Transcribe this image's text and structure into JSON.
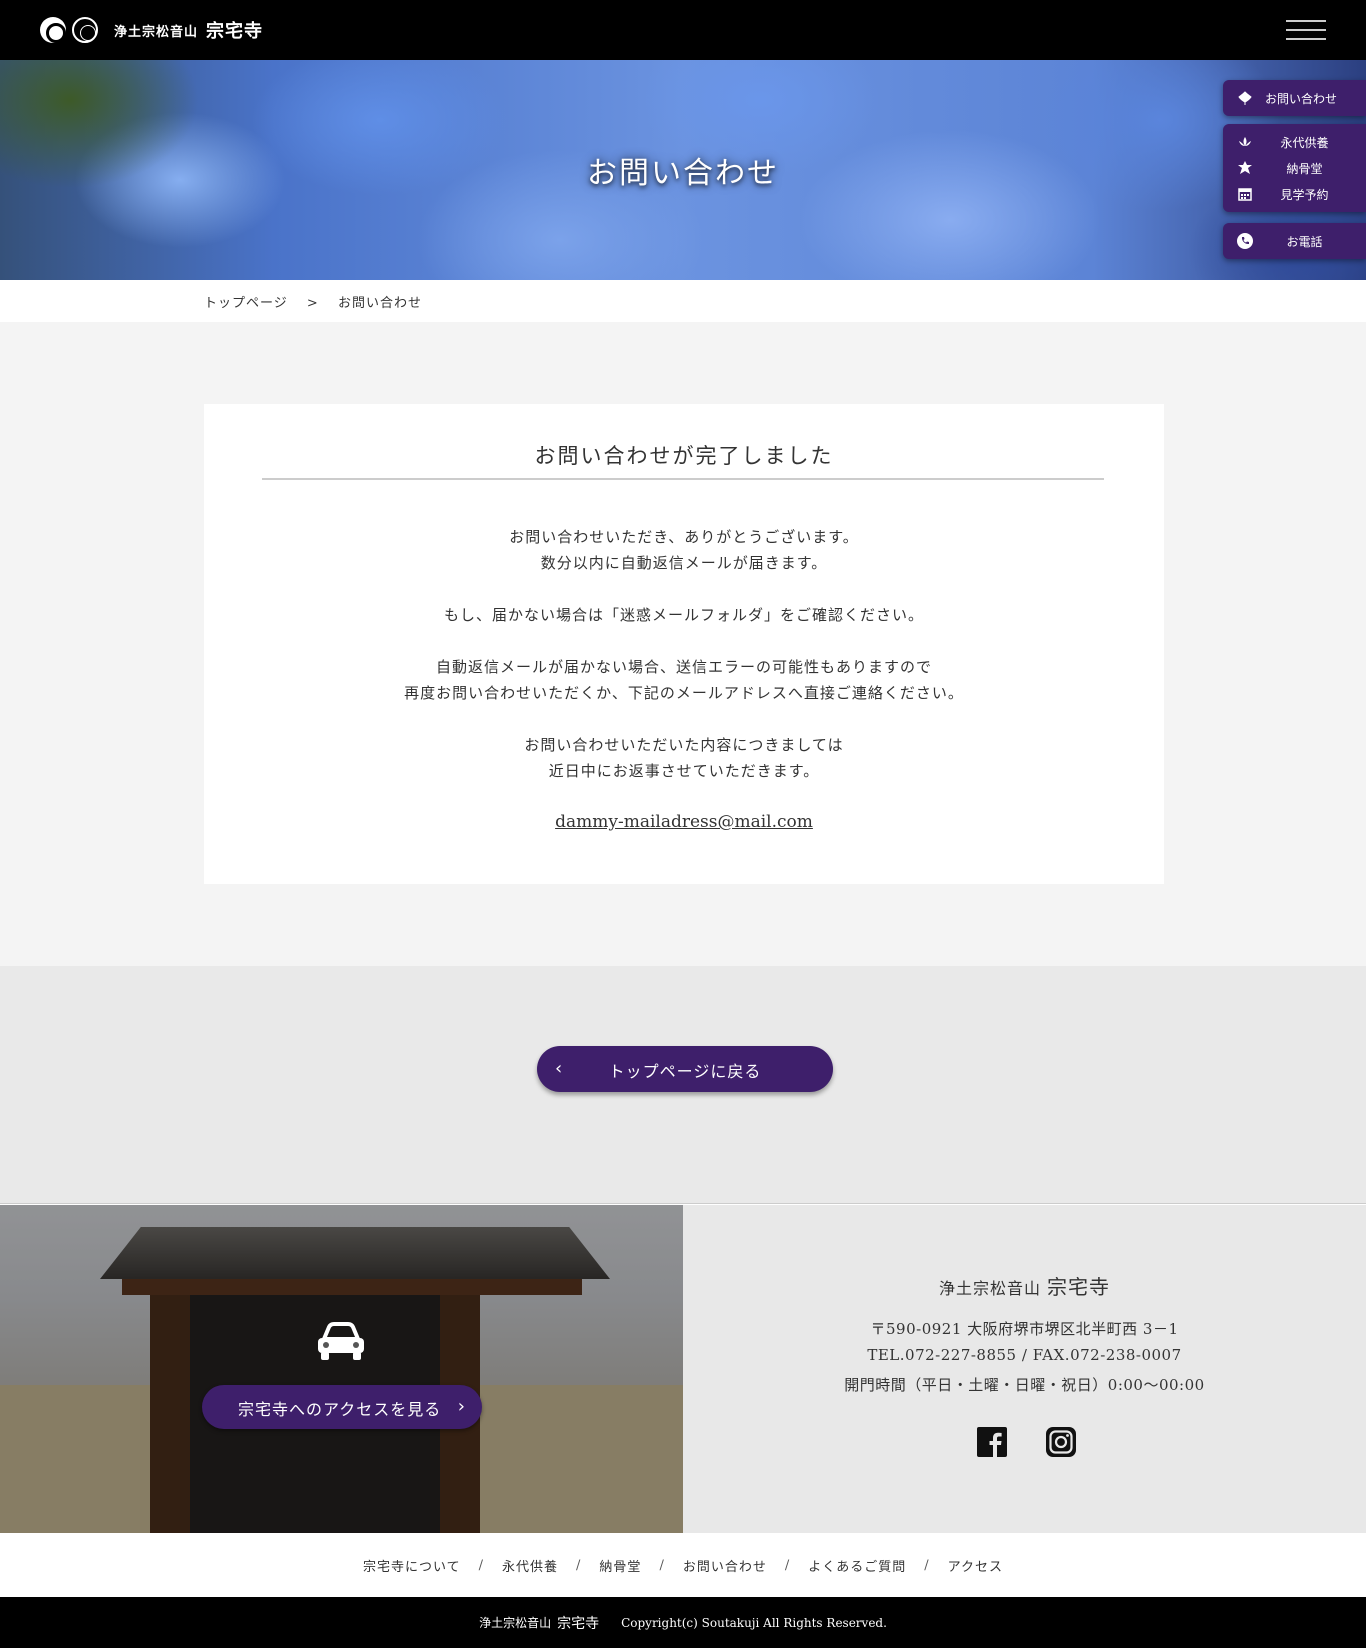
{
  "header": {
    "logo_small": "浄土宗松音山",
    "logo_big": "宗宅寺",
    "menu_icon": "hamburger-menu-icon"
  },
  "hero": {
    "title": "お問い合わせ"
  },
  "side_nav": {
    "contact": {
      "label": "お問い合わせ",
      "icon": "lotus-icon"
    },
    "links": [
      {
        "label": "永代供養",
        "icon": "lotus-flower-icon"
      },
      {
        "label": "納骨堂",
        "icon": "leaf-icon"
      },
      {
        "label": "見学予約",
        "icon": "calendar-icon"
      }
    ],
    "phone": {
      "label": "お電話",
      "icon": "phone-icon"
    }
  },
  "breadcrumb": {
    "home": "トップページ",
    "separator": ">",
    "current": "お問い合わせ"
  },
  "card": {
    "title": "お問い合わせが完了しました",
    "lines": [
      "お問い合わせいただき、ありがとうございます。",
      "数分以内に自動返信メールが届きます。",
      "もし、届かない場合は「迷惑メールフォルダ」をご確認ください。",
      "自動返信メールが届かない場合、送信エラーの可能性もありますので",
      "再度お問い合わせいただくか、下記のメールアドレスへ直接ご連絡ください。",
      "お問い合わせいただいた内容につきましては",
      "近日中にお返事させていただきます。"
    ],
    "email": "dammy-mailadress@mail.com"
  },
  "back_button": {
    "label": "トップページに戻る",
    "icon": "chevron-left-icon"
  },
  "access": {
    "button_label": "宗宅寺へのアクセスを見る",
    "car_icon": "car-icon",
    "chevron_icon": "chevron-right-icon"
  },
  "info": {
    "name_small": "浄土宗松音山",
    "name_big": "宗宅寺",
    "address": "〒590-0921 大阪府堺市堺区北半町西 3－1",
    "tel_fax": "TEL.072-227-8855 / FAX.072-238-0007",
    "hours": "開門時間（平日・土曜・日曜・祝日）0:00〜00:00",
    "social": [
      "facebook-icon",
      "instagram-icon"
    ]
  },
  "footer_nav": [
    "宗宅寺について",
    "永代供養",
    "納骨堂",
    "お問い合わせ",
    "よくあるご質問",
    "アクセス"
  ],
  "footer_nav_separator": "/",
  "copyright": {
    "name_small": "浄土宗松音山",
    "name_big": "宗宅寺",
    "text": "Copyright(c) Soutakuji All Rights Reserved."
  },
  "colors": {
    "accent": "#3e1f6b",
    "header_bg": "#000000",
    "page_bg": "#f4f4f4"
  }
}
